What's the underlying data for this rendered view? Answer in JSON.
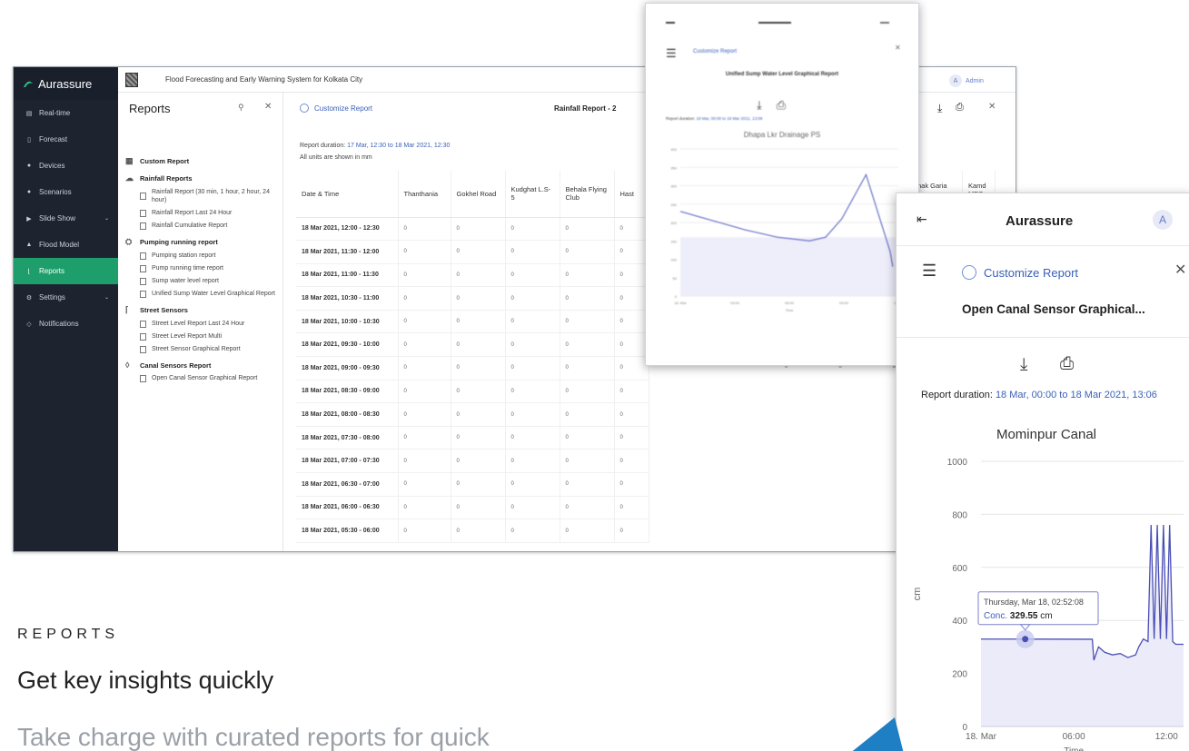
{
  "app": {
    "brand": "Aurassure",
    "system_title": "Flood Forecasting and Early Warning System for Kolkata City",
    "nav": [
      {
        "label": "Real-time",
        "icon": "table-icon",
        "glyph": "▤"
      },
      {
        "label": "Forecast",
        "icon": "file-icon",
        "glyph": "▯"
      },
      {
        "label": "Devices",
        "icon": "devices-icon",
        "glyph": "●"
      },
      {
        "label": "Scenarios",
        "icon": "scenario-icon",
        "glyph": "●"
      },
      {
        "label": "Slide Show",
        "icon": "play-icon",
        "glyph": "▶"
      },
      {
        "label": "Flood Model",
        "icon": "flood-icon",
        "glyph": "▲"
      },
      {
        "label": "Reports",
        "icon": "chart-icon",
        "glyph": "⌊"
      },
      {
        "label": "Settings",
        "icon": "gear-icon",
        "glyph": "⚙"
      },
      {
        "label": "Notifications",
        "icon": "bell-icon",
        "glyph": "◇"
      }
    ],
    "reports_panel": {
      "title": "Reports",
      "custom_report": "Custom Report",
      "groups": [
        {
          "title": "Rainfall Reports",
          "items": [
            "Rainfall Report (30 min, 1 hour, 2 hour, 24 hour)",
            "Rainfall Report Last 24 Hour",
            "Rainfall Cumulative Report"
          ]
        },
        {
          "title": "Pumping running report",
          "items": [
            "Pumping station report",
            "Pump running time report",
            "Sump water level report",
            "Unified Sump Water Level Graphical Report"
          ]
        },
        {
          "title": "Street Sensors",
          "items": [
            "Street Level Report Last 24 Hour",
            "Street Level Report Multi",
            "Street Sensor Graphical Report"
          ]
        },
        {
          "title": "Canal Sensors Report",
          "items": [
            "Open Canal Sensor Graphical Report"
          ]
        }
      ]
    },
    "main": {
      "customize": "Customize Report",
      "report_title": "Rainfall Report - 2",
      "duration_label": "Report duration: ",
      "duration_value": "17 Mar, 12:30 to 18 Mar 2021, 12:30",
      "units_note": "All units are shown in mm",
      "columns": [
        "Date & Time",
        "Thanthania",
        "Gokhel Road",
        "Kudghat L.S-5",
        "Behala Flying Club",
        "Hast"
      ],
      "rows": [
        [
          "18 Mar 2021, 12:00 - 12:30",
          "0",
          "0",
          "0",
          "0",
          "0"
        ],
        [
          "18 Mar 2021, 11:30 - 12:00",
          "0",
          "0",
          "0",
          "0",
          "0"
        ],
        [
          "18 Mar 2021, 11:00 - 11:30",
          "0",
          "0",
          "0",
          "0",
          "0"
        ],
        [
          "18 Mar 2021, 10:30 - 11:00",
          "0",
          "0",
          "0",
          "0",
          "0"
        ],
        [
          "18 Mar 2021, 10:00 - 10:30",
          "0",
          "0",
          "0",
          "0",
          "0"
        ],
        [
          "18 Mar 2021, 09:30 - 10:00",
          "0",
          "0",
          "0",
          "0",
          "0"
        ],
        [
          "18 Mar 2021, 09:00 - 09:30",
          "0",
          "0",
          "0",
          "0",
          "0"
        ],
        [
          "18 Mar 2021, 08:30 - 09:00",
          "0",
          "0",
          "0",
          "0",
          "0"
        ],
        [
          "18 Mar 2021, 08:00 - 08:30",
          "0",
          "0",
          "0",
          "0",
          "0"
        ],
        [
          "18 Mar 2021, 07:30 - 08:00",
          "0",
          "0",
          "0",
          "0",
          "0"
        ],
        [
          "18 Mar 2021, 07:00 - 07:30",
          "0",
          "0",
          "0",
          "0",
          "0"
        ],
        [
          "18 Mar 2021, 06:30 - 07:00",
          "0",
          "0",
          "0",
          "0",
          "0"
        ],
        [
          "18 Mar 2021, 06:00 - 06:30",
          "0",
          "0",
          "0",
          "0",
          "0"
        ],
        [
          "18 Mar 2021, 05:30 - 06:00",
          "0",
          "0",
          "0",
          "0",
          "0"
        ]
      ],
      "extra_columns": [
        "hak Garia",
        "Kamd MPS"
      ],
      "extra_values": [
        "0",
        "0",
        "0",
        "0"
      ]
    },
    "admin": {
      "initial": "A",
      "label": "Admin"
    }
  },
  "overlay_sump": {
    "customize": "Customize Report",
    "title": "Unified Sump Water Level Graphical Report",
    "duration_label": "Report duration: ",
    "duration_value": "18 Mar, 00:00 to 18 Mar 2021, 13:09",
    "chart_title": "Dhapa Lkr Drainage PS",
    "xlabel": "Time",
    "y_ticks": [
      "400",
      "350",
      "300",
      "250",
      "200",
      "150",
      "100",
      "50",
      "0"
    ],
    "x_ticks": [
      "18. Mar",
      "03:00",
      "06:00",
      "09:00",
      "12:00"
    ]
  },
  "overlay_canal": {
    "brand": "Aurassure",
    "avatar": "A",
    "customize": "Customize Report",
    "title": "Open Canal Sensor Graphical...",
    "duration_label": "Report duration: ",
    "duration_value": "18 Mar, 00:00 to 18 Mar 2021, 13:06",
    "tooltip": {
      "date": "Thursday, Mar 18, 02:52:08",
      "label": "Conc.",
      "value": "329.55",
      "unit": "cm"
    }
  },
  "chart_data": [
    {
      "type": "line",
      "title": "Dhapa Lkr Drainage PS",
      "xlabel": "Time",
      "ylabel": "",
      "x": [
        0,
        2,
        4,
        6,
        8,
        9,
        10,
        11.5,
        12.5,
        13,
        13.15
      ],
      "y": [
        230,
        205,
        180,
        160,
        150,
        160,
        210,
        330,
        190,
        120,
        80
      ],
      "xlim": [
        0,
        13.5
      ],
      "ylim": [
        0,
        400
      ]
    },
    {
      "type": "line",
      "title": "Mominpur Canal",
      "xlabel": "Time",
      "ylabel": "cm",
      "ylim": [
        0,
        1000
      ],
      "xlim": [
        0,
        13.1
      ],
      "y_ticks": [
        "0",
        "200",
        "400",
        "600",
        "800",
        "1000"
      ],
      "x_ticks": [
        {
          "x": 0,
          "label": "18. Mar"
        },
        {
          "x": 6,
          "label": "06:00"
        },
        {
          "x": 12,
          "label": "12:00"
        }
      ],
      "x": [
        0,
        2.86,
        7.2,
        7.3,
        7.6,
        8.0,
        8.5,
        9.0,
        9.5,
        10.0,
        10.2,
        10.5,
        10.8,
        11.0,
        11.2,
        11.4,
        11.6,
        11.8,
        12.0,
        12.2,
        12.4,
        12.6,
        13.1
      ],
      "y": [
        329.55,
        329.55,
        329,
        250,
        300,
        280,
        270,
        275,
        260,
        270,
        300,
        330,
        320,
        760,
        330,
        760,
        330,
        760,
        330,
        760,
        320,
        310,
        310
      ],
      "highlight": {
        "x": 2.86,
        "y": 329.55
      }
    }
  ],
  "marketing": {
    "kicker": "REPORTS",
    "headline": "Get key insights quickly",
    "subline": "Take charge with curated reports for quick"
  },
  "colors": {
    "sidebar": "#1d2430",
    "active": "#1e9e6a",
    "link": "#3a5fb8",
    "series": "#4a4fb5"
  }
}
